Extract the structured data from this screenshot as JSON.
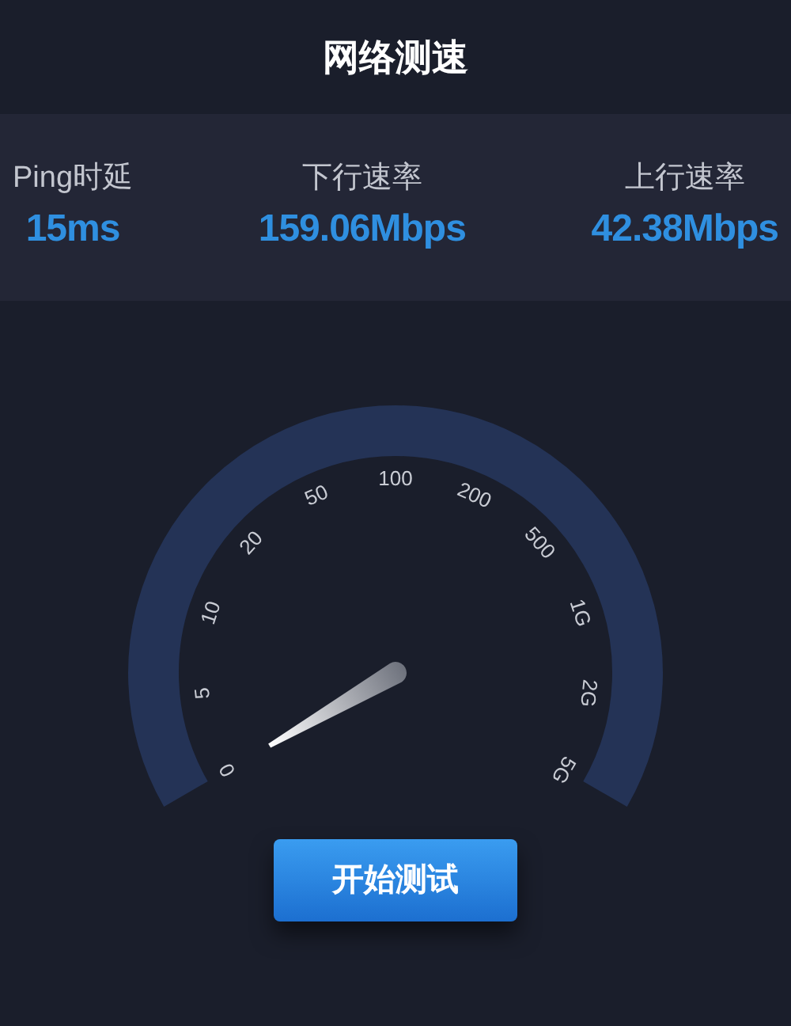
{
  "title": "网络测速",
  "stats": [
    {
      "label": "Ping时延",
      "value": "15ms"
    },
    {
      "label": "下行速率",
      "value": "159.06Mbps"
    },
    {
      "label": "上行速率",
      "value": "42.38Mbps"
    }
  ],
  "gauge": {
    "scale": [
      "0",
      "5",
      "10",
      "20",
      "50",
      "100",
      "200",
      "500",
      "1G",
      "2G",
      "5G"
    ]
  },
  "button": "开始测试"
}
